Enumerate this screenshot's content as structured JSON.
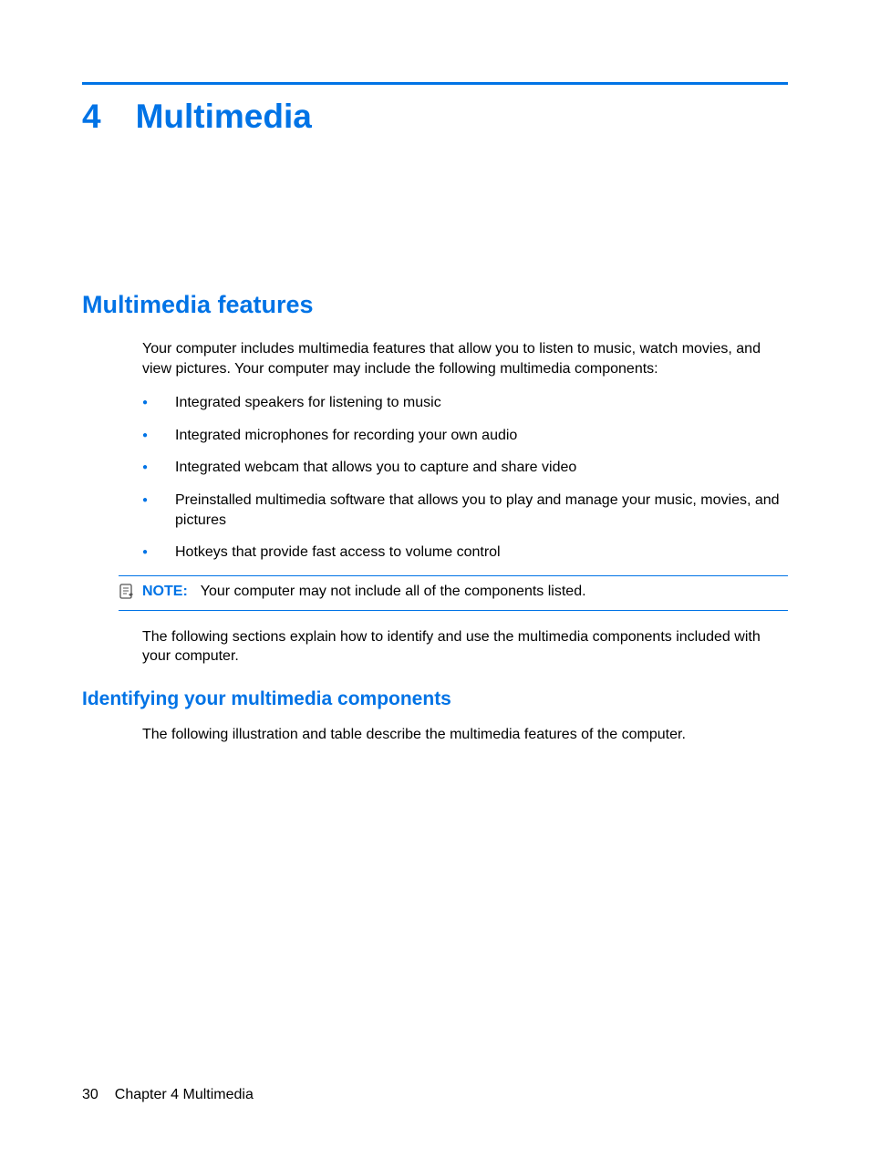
{
  "chapter": {
    "number": "4",
    "title": "Multimedia"
  },
  "section1": {
    "heading": "Multimedia features",
    "intro": "Your computer includes multimedia features that allow you to listen to music, watch movies, and view pictures. Your computer may include the following multimedia components:",
    "bullets": [
      "Integrated speakers for listening to music",
      "Integrated microphones for recording your own audio",
      "Integrated webcam that allows you to capture and share video",
      "Preinstalled multimedia software that allows you to play and manage your music, movies, and pictures",
      "Hotkeys that provide fast access to volume control"
    ],
    "note": {
      "label": "NOTE:",
      "text": "Your computer may not include all of the components listed."
    },
    "followup": "The following sections explain how to identify and use the multimedia components included with your computer."
  },
  "subsection1": {
    "heading": "Identifying your multimedia components",
    "text": "The following illustration and table describe the multimedia features of the computer."
  },
  "footer": {
    "page": "30",
    "label": "Chapter 4   Multimedia"
  }
}
